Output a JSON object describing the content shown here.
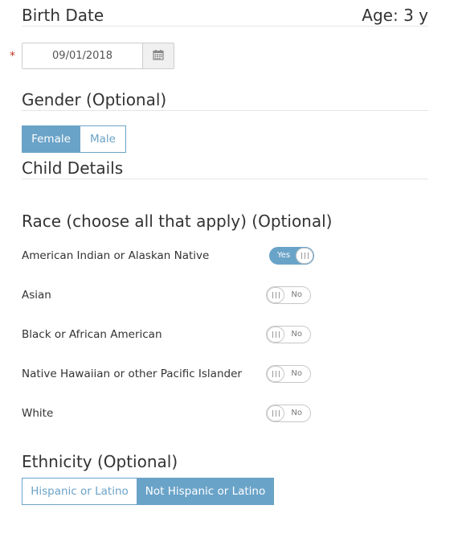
{
  "birth_date": {
    "title": "Birth Date",
    "age": "Age: 3 y",
    "required_marker": "*",
    "value": "09/01/2018"
  },
  "gender": {
    "title": "Gender (Optional)",
    "options": [
      "Female",
      "Male"
    ],
    "selected": "Female"
  },
  "child_details": {
    "title": "Child Details"
  },
  "race": {
    "title": "Race (choose all that apply) (Optional)",
    "items": [
      {
        "label": "American Indian or Alaskan Native",
        "state": "Yes"
      },
      {
        "label": "Asian",
        "state": "No"
      },
      {
        "label": "Black or African American",
        "state": "No"
      },
      {
        "label": "Native Hawaiian or other Pacific Islander",
        "state": "No"
      },
      {
        "label": "White",
        "state": "No"
      }
    ]
  },
  "ethnicity": {
    "title": "Ethnicity (Optional)",
    "options": [
      "Hispanic or Latino",
      "Not Hispanic or Latino"
    ],
    "selected": "Not Hispanic or Latino"
  },
  "colors": {
    "accent": "#6aa3c8",
    "required": "#c0392b",
    "divider": "#e5e5e5"
  },
  "icons": {
    "calendar": "calendar-icon",
    "toggle_grip": "grip-icon"
  }
}
